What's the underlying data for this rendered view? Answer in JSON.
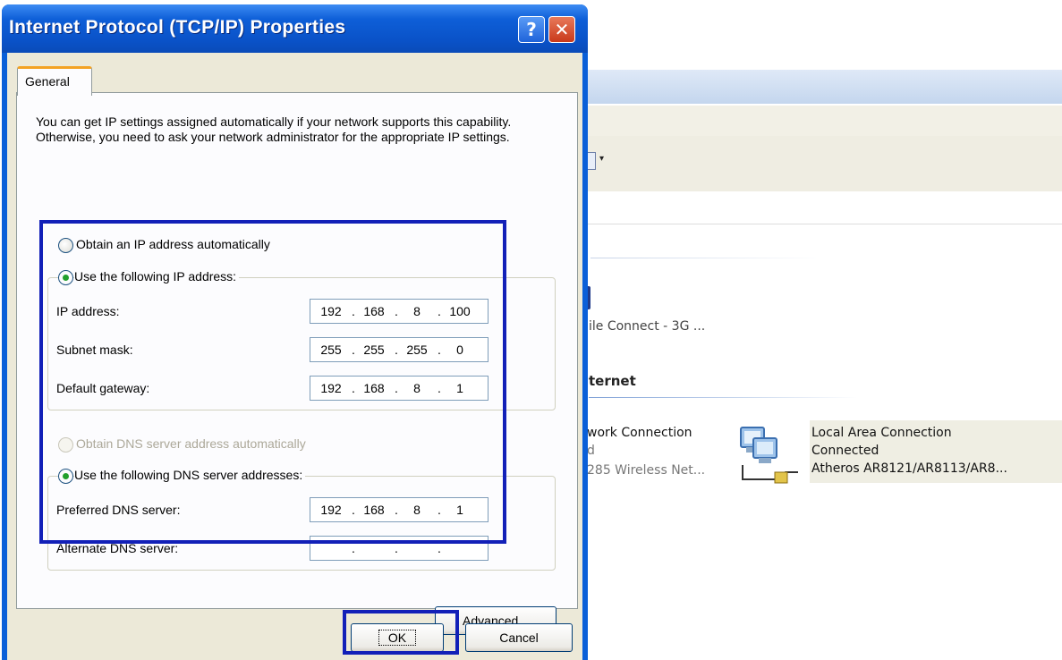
{
  "dialog": {
    "title": "Internet Protocol (TCP/IP) Properties",
    "help_glyph": "?",
    "close_glyph": "✕",
    "tab_general": "General",
    "intro_text": "You can get IP settings assigned automatically if your network supports this capability. Otherwise, you need to ask your network administrator for the appropriate IP settings.",
    "radio_auto_ip": "Obtain an IP address automatically",
    "radio_manual_ip": "Use the following IP address:",
    "ip_address_label": "IP address:",
    "ip_address": [
      "192",
      "168",
      "8",
      "100"
    ],
    "subnet_mask_label": "Subnet mask:",
    "subnet_mask": [
      "255",
      "255",
      "255",
      "0"
    ],
    "default_gateway_label": "Default gateway:",
    "default_gateway": [
      "192",
      "168",
      "8",
      "1"
    ],
    "radio_auto_dns": "Obtain DNS server address automatically",
    "radio_manual_dns": "Use the following DNS server addresses:",
    "preferred_dns_label": "Preferred DNS server:",
    "preferred_dns": [
      "192",
      "168",
      "8",
      "1"
    ],
    "alternate_dns_label": "Alternate DNS server:",
    "alternate_dns": [
      "",
      "",
      "",
      ""
    ],
    "dot": ".",
    "advanced_button": "Advanced...",
    "ok_button": "OK",
    "cancel_button": "Cancel",
    "selected_ip_mode": "manual",
    "selected_dns_mode": "manual"
  },
  "background_window": {
    "views_arrow": "▾",
    "item1_partial": "ile Connect - 3G ...",
    "section_heading_partial": "ternet",
    "item2_line1_partial": "work Connection",
    "item2_line2_partial": "d",
    "item2_line3_partial": "285 Wireless Net...",
    "lan_name": "Local Area Connection",
    "lan_status": "Connected",
    "lan_adapter": "Atheros AR8121/AR8113/AR8..."
  },
  "colors": {
    "highlight_border": "#1220b8",
    "titlebar_blue": "#0a52c8",
    "dialog_face": "#ece9d8"
  }
}
